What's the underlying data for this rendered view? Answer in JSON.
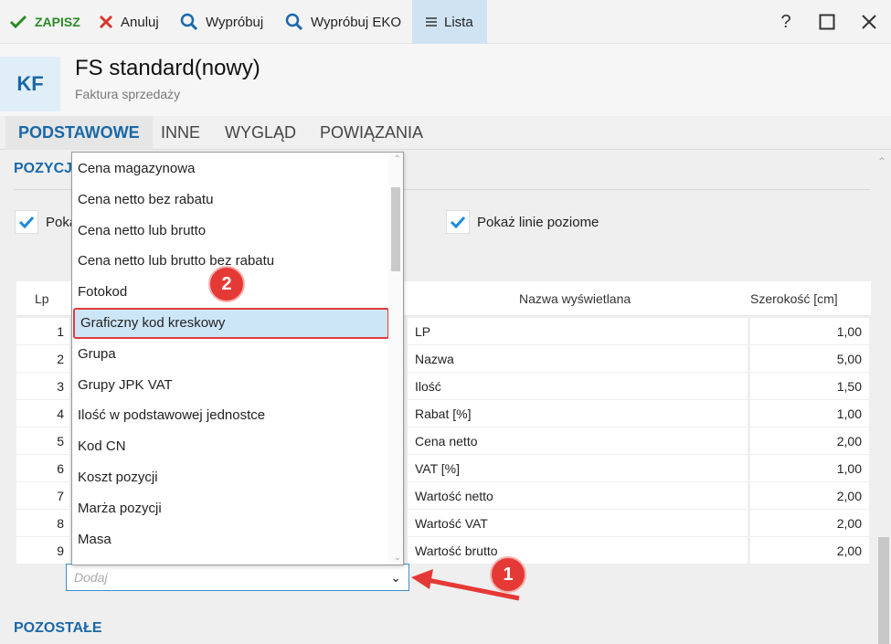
{
  "toolbar": {
    "save_label": "ZAPISZ",
    "cancel_label": "Anuluj",
    "try_label": "Wypróbuj",
    "try_eko_label": "Wypróbuj EKO",
    "list_label": "Lista",
    "help_label": "?"
  },
  "header": {
    "badge": "KF",
    "title": "FS standard(nowy)",
    "subtitle": "Faktura sprzedaży"
  },
  "tabs": [
    {
      "label": "PODSTAWOWE"
    },
    {
      "label": "INNE"
    },
    {
      "label": "WYGLĄD"
    },
    {
      "label": "POWIĄZANIA"
    }
  ],
  "section": {
    "positions_title": "POZYCJE",
    "others_title": "POZOSTAŁE"
  },
  "options": {
    "first_checkbox_label": "Pokaż linie pionowe",
    "second_checkbox_label": "Pokaż linie poziome"
  },
  "table": {
    "columns": [
      "Lp",
      "Nazwa wyświetlana",
      "Szerokość [cm]"
    ],
    "rows": [
      {
        "lp": "1",
        "name": "LP",
        "width": "1,00"
      },
      {
        "lp": "2",
        "name": "Nazwa",
        "width": "5,00"
      },
      {
        "lp": "3",
        "name": "Ilość",
        "width": "1,50"
      },
      {
        "lp": "4",
        "name": "Rabat [%]",
        "width": "1,00"
      },
      {
        "lp": "5",
        "name": "Cena netto",
        "width": "2,00"
      },
      {
        "lp": "6",
        "name": "VAT [%]",
        "width": "1,00"
      },
      {
        "lp": "7",
        "name": "Wartość netto",
        "width": "2,00"
      },
      {
        "lp": "8",
        "name": "Wartość VAT",
        "width": "2,00"
      },
      {
        "lp": "9",
        "name": "Wartość brutto",
        "width": "2,00"
      }
    ]
  },
  "add_combo": {
    "placeholder": "Dodaj"
  },
  "dropdown": {
    "items": [
      "Cena magazynowa",
      "Cena netto bez rabatu",
      "Cena netto lub brutto",
      "Cena netto lub brutto bez rabatu",
      "Fotokod",
      "Graficzny kod kreskowy",
      "Grupa",
      "Grupy JPK VAT",
      "Ilość w podstawowej jednostce",
      "Kod CN",
      "Koszt pozycji",
      "Marża pozycji",
      "Masa"
    ],
    "selected": "Graficzny kod kreskowy"
  },
  "annotations": {
    "badge_1": "1",
    "badge_2": "2"
  },
  "colors": {
    "accent": "#1a68a8",
    "save_green": "#2a8a26",
    "annotation_red": "#e53935",
    "selected_bg": "#cde6f7"
  }
}
